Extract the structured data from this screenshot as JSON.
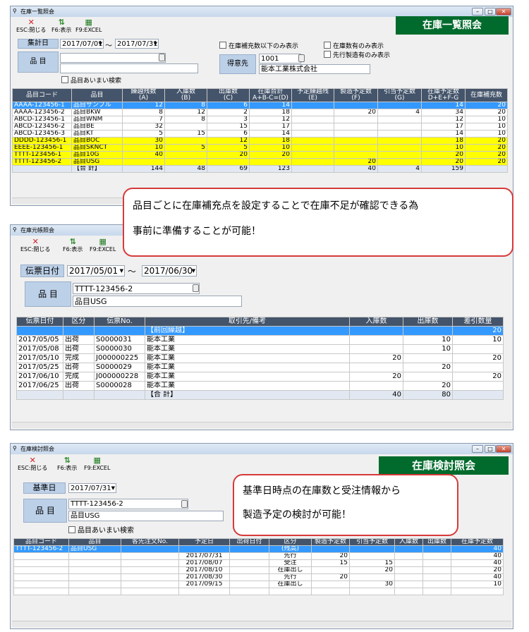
{
  "toolbar": {
    "esc": "ESC:閉じる",
    "f6": "F6:表示",
    "f9": "F9:EXCEL"
  },
  "w1": {
    "title": "在庫一覧照会",
    "banner": "在庫一覧照会",
    "date_label": "集計日",
    "date_from": "2017/07/01",
    "tilde": "～",
    "date_to": "2017/07/31",
    "item_label": "品 目",
    "item_fuzzy": "品目あいまい検索",
    "chk_replenish": "在庫補充数以下のみ表示",
    "chk_stock": "在庫数有のみ表示",
    "chk_advance": "先行製造有のみ表示",
    "customer_label": "得意先",
    "customer_code": "1001",
    "customer_name": "能本工業株式会社",
    "headers": [
      [
        "品目コード",
        ""
      ],
      [
        "品目",
        ""
      ],
      [
        "繰越残数",
        "(A)"
      ],
      [
        "入庫数",
        "(B)"
      ],
      [
        "出庫数",
        "(C)"
      ],
      [
        "在庫合計",
        "A+B-C=(D)"
      ],
      [
        "予定繰越残",
        "(E)"
      ],
      [
        "製造予定数",
        "(F)"
      ],
      [
        "引当予定数",
        "(G)"
      ],
      [
        "在庫予定数",
        "D+E+F-G"
      ],
      [
        "在庫補充数",
        ""
      ]
    ],
    "rows": [
      {
        "s": "sel",
        "c": [
          "AAAA-123456-1",
          "品目サンプル",
          "12",
          "8",
          "6",
          "14",
          "",
          "",
          "",
          "14",
          "20"
        ]
      },
      {
        "s": "",
        "c": [
          "AAAA-123456-2",
          "品目BKW",
          "8",
          "12",
          "2",
          "18",
          "",
          "20",
          "4",
          "34",
          "20"
        ]
      },
      {
        "s": "",
        "c": [
          "ABCD-123456-1",
          "品目WNM",
          "7",
          "8",
          "3",
          "12",
          "",
          "",
          "",
          "12",
          "10"
        ]
      },
      {
        "s": "",
        "c": [
          "ABCD-123456-2",
          "品目BE",
          "32",
          "",
          "15",
          "17",
          "",
          "",
          "",
          "17",
          "10"
        ]
      },
      {
        "s": "",
        "c": [
          "ABCD-123456-3",
          "品目KT",
          "5",
          "15",
          "6",
          "14",
          "",
          "",
          "",
          "14",
          "10"
        ]
      },
      {
        "s": "yel",
        "c": [
          "DDDD-123456-1",
          "品目BOC",
          "30",
          "",
          "12",
          "18",
          "",
          "",
          "",
          "18",
          "20"
        ]
      },
      {
        "s": "yel",
        "c": [
          "EEEE-123456-1",
          "品目SKNCT",
          "10",
          "5",
          "5",
          "10",
          "",
          "",
          "",
          "10",
          "20"
        ]
      },
      {
        "s": "yel",
        "c": [
          "TTTT-123456-1",
          "品目10G",
          "40",
          "",
          "20",
          "20",
          "",
          "",
          "",
          "20",
          "20"
        ]
      },
      {
        "s": "yel",
        "c": [
          "TTTT-123456-2",
          "品目USG",
          "",
          "",
          "",
          "",
          "",
          "20",
          "",
          "20",
          "20"
        ]
      },
      {
        "s": "tot",
        "c": [
          "",
          "【合 計】",
          "144",
          "48",
          "69",
          "123",
          "",
          "40",
          "4",
          "159",
          ""
        ]
      }
    ]
  },
  "callout1": {
    "line1": "品目ごとに在庫補充点を設定することで在庫不足が確認できる為",
    "line2": "事前に準備することが可能！"
  },
  "w2": {
    "title": "在庫元帳照会",
    "date_label": "伝票日付",
    "date_from": "2017/05/01",
    "tilde": "～",
    "date_to": "2017/06/30",
    "item_label": "品 目",
    "item_code": "TTTT-123456-2",
    "item_name": "品目USG",
    "headers": [
      "伝票日付",
      "区分",
      "伝票No.",
      "取引先/備考",
      "入庫数",
      "出庫数",
      "差引数量"
    ],
    "rows": [
      {
        "s": "sel",
        "c": [
          "",
          "",
          "",
          "【前回繰越】",
          "",
          "",
          "20"
        ]
      },
      {
        "s": "",
        "c": [
          "2017/05/05",
          "出荷",
          "S0000031",
          "能本工業",
          "",
          "10",
          "10"
        ]
      },
      {
        "s": "",
        "c": [
          "2017/05/08",
          "出荷",
          "S0000030",
          "能本工業",
          "",
          "10",
          ""
        ]
      },
      {
        "s": "",
        "c": [
          "2017/05/10",
          "完成",
          "J000000225",
          "能本工業",
          "20",
          "",
          "20"
        ]
      },
      {
        "s": "",
        "c": [
          "2017/05/25",
          "出荷",
          "S0000029",
          "能本工業",
          "",
          "20",
          ""
        ]
      },
      {
        "s": "",
        "c": [
          "2017/06/10",
          "完成",
          "J000000228",
          "能本工業",
          "20",
          "",
          "20"
        ]
      },
      {
        "s": "",
        "c": [
          "2017/06/25",
          "出荷",
          "S0000028",
          "能本工業",
          "",
          "20",
          ""
        ]
      },
      {
        "s": "tot",
        "c": [
          "",
          "",
          "",
          "【合 計】",
          "40",
          "80",
          ""
        ]
      }
    ]
  },
  "w3": {
    "title": "在庫検討照会",
    "banner": "在庫検討照会",
    "date_label": "基準日",
    "date": "2017/07/31",
    "item_label": "品 目",
    "item_code": "TTTT-123456-2",
    "item_name": "品目USG",
    "item_fuzzy": "品目あいまい検索",
    "headers": [
      "品目コード",
      "品目",
      "客先注文No.",
      "予定日",
      "出荷日付",
      "区分",
      "製造予定数",
      "引当予定数",
      "入庫数",
      "出庫数",
      "在庫予定数"
    ],
    "rows": [
      {
        "s": "sel",
        "c": [
          "TTTT-123456-2",
          "品目USG",
          "",
          "",
          "",
          "(残高)",
          "",
          "",
          "",
          "",
          "40"
        ]
      },
      {
        "s": "",
        "c": [
          "",
          "",
          "",
          "2017/07/31",
          "",
          "先行",
          "20",
          "",
          "",
          "",
          "40"
        ]
      },
      {
        "s": "",
        "c": [
          "",
          "",
          "",
          "2017/08/07",
          "",
          "受注",
          "15",
          "15",
          "",
          "",
          "40"
        ]
      },
      {
        "s": "",
        "c": [
          "",
          "",
          "",
          "2017/08/10",
          "",
          "在庫出し",
          "",
          "20",
          "",
          "",
          "20"
        ]
      },
      {
        "s": "",
        "c": [
          "",
          "",
          "",
          "2017/08/30",
          "",
          "先行",
          "20",
          "",
          "",
          "",
          "40"
        ]
      },
      {
        "s": "",
        "c": [
          "",
          "",
          "",
          "2017/09/15",
          "",
          "在庫出し",
          "",
          "30",
          "",
          "",
          "10"
        ]
      }
    ]
  },
  "callout2": {
    "line1": "基準日時点の在庫数と受注情報から",
    "line2": "製造予定の検討が可能！"
  }
}
